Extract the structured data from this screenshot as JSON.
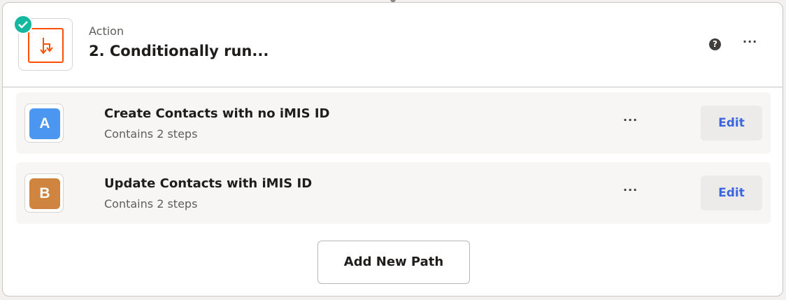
{
  "step": {
    "type_label": "Action",
    "title": "2. Conditionally run...",
    "status": "complete",
    "icon": "paths-icon",
    "accent_color": "#ff4f00",
    "status_color": "#14b89f"
  },
  "header_actions": {
    "help_glyph": "?",
    "more_glyph": "···"
  },
  "paths": [
    {
      "letter": "A",
      "color": "#4b96f0",
      "name": "Create Contacts with no iMIS ID",
      "subtitle": "Contains 2 steps",
      "more_glyph": "···",
      "edit_label": "Edit"
    },
    {
      "letter": "B",
      "color": "#cf8540",
      "name": "Update Contacts with iMIS ID",
      "subtitle": "Contains 2 steps",
      "more_glyph": "···",
      "edit_label": "Edit"
    }
  ],
  "add_path_label": "Add New Path"
}
